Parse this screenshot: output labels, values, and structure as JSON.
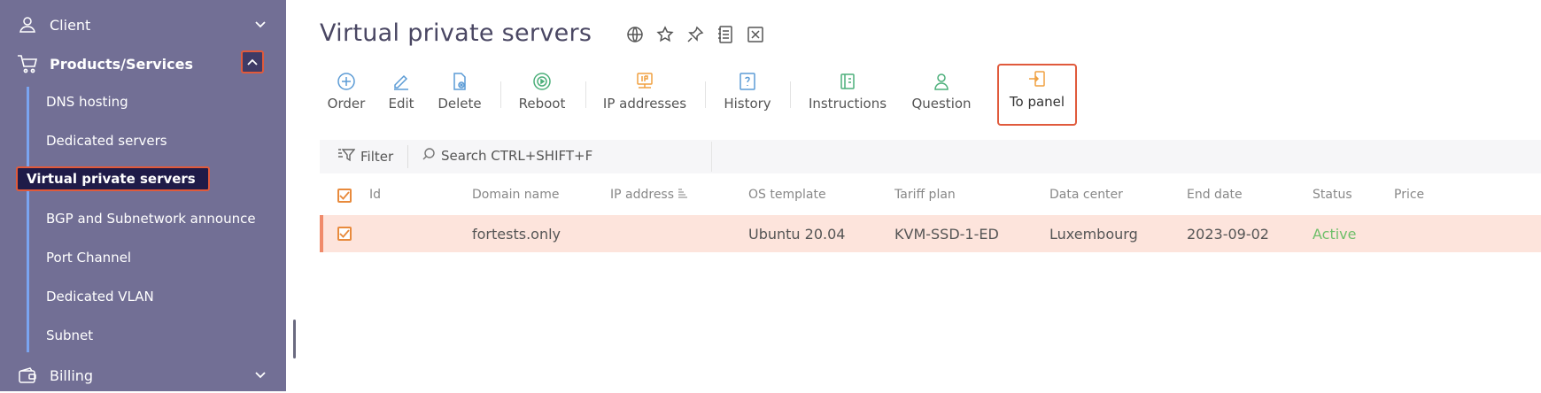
{
  "sidebar": {
    "client": "Client",
    "products": "Products/Services",
    "items": [
      "DNS hosting",
      "Dedicated servers",
      "Virtual private servers",
      "BGP and Subnetwork announce",
      "Port Channel",
      "Dedicated VLAN",
      "Subnet"
    ],
    "billing": "Billing"
  },
  "page": {
    "title": "Virtual private servers"
  },
  "toolbar": {
    "order": "Order",
    "edit": "Edit",
    "delete": "Delete",
    "reboot": "Reboot",
    "ip_addresses": "IP addresses",
    "history": "History",
    "instructions": "Instructions",
    "question": "Question",
    "to_panel": "To panel"
  },
  "filter": {
    "label": "Filter",
    "search_placeholder": "Search CTRL+SHIFT+F"
  },
  "table": {
    "columns": [
      "Id",
      "Domain name",
      "IP address",
      "OS template",
      "Tariff plan",
      "Data center",
      "End date",
      "Status",
      "Price"
    ],
    "rows": [
      {
        "id": "",
        "domain": "fortests.only",
        "ip": "",
        "os": "Ubuntu 20.04",
        "tariff": "KVM-SSD-1-ED",
        "datacenter": "Luxembourg",
        "end_date": "2023-09-02",
        "status": "Active",
        "price": ""
      }
    ]
  },
  "colors": {
    "sidebar_bg": "#726f95",
    "highlight_border": "#e05a3c",
    "row_selected": "#fde4dc",
    "status_active": "#6fbf6a",
    "toolbar_blue": "#5b9bd5",
    "toolbar_orange": "#f0a040",
    "toolbar_green": "#4caf7a"
  }
}
